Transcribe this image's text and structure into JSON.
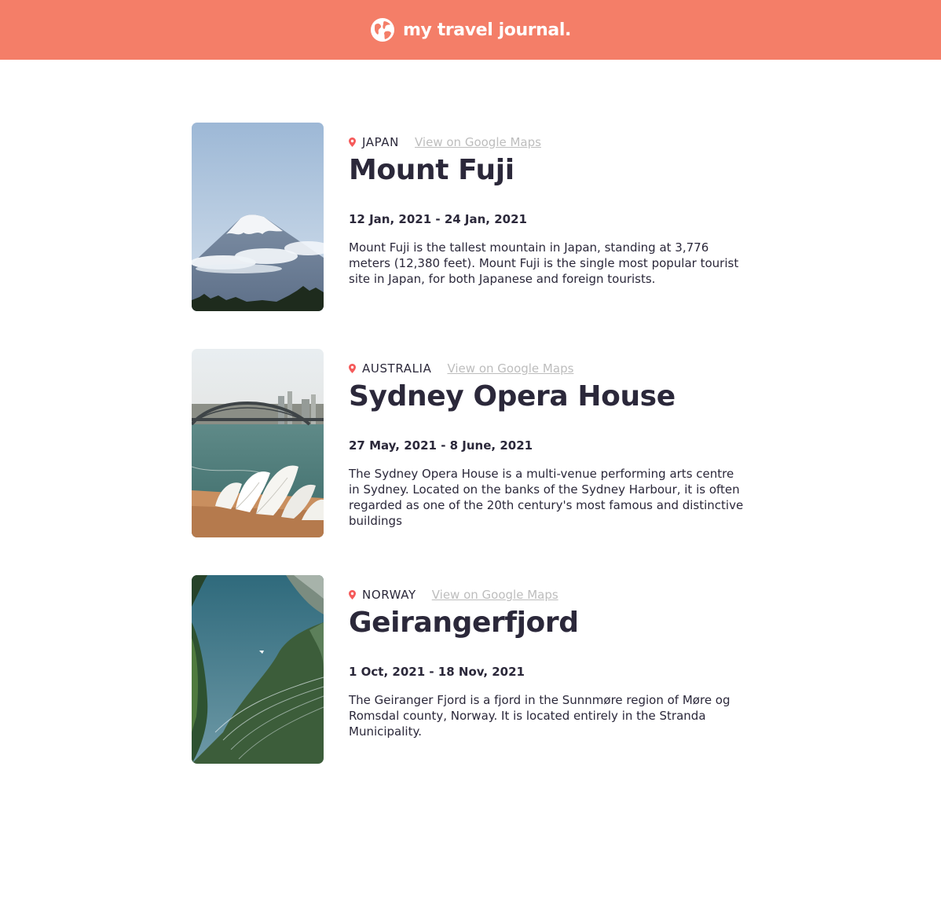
{
  "header": {
    "title": "my travel journal.",
    "icon": "globe-icon",
    "background": "#f47e68"
  },
  "entries": [
    {
      "country": "JAPAN",
      "maps_link": "View on Google Maps",
      "title": "Mount Fuji",
      "dates": "12 Jan, 2021 - 24 Jan, 2021",
      "description": "Mount Fuji is the tallest mountain in Japan, standing at 3,776 meters (12,380 feet). Mount Fuji is the single most popular tourist site in Japan, for both Japanese and foreign tourists."
    },
    {
      "country": "AUSTRALIA",
      "maps_link": "View on Google Maps",
      "title": "Sydney Opera House",
      "dates": "27 May, 2021 - 8 June, 2021",
      "description": "The Sydney Opera House is a multi-venue performing arts centre in Sydney. Located on the banks of the Sydney Harbour, it is often regarded as one of the 20th century's most famous and distinctive buildings"
    },
    {
      "country": "NORWAY",
      "maps_link": "View on Google Maps",
      "title": "Geirangerfjord",
      "dates": "1 Oct, 2021 - 18 Nov, 2021",
      "description": "The Geiranger Fjord is a fjord in the Sunnmøre region of Møre og Romsdal county, Norway. It is located entirely in the Stranda Municipality."
    }
  ],
  "colors": {
    "accent": "#f47e68",
    "text": "#2b283a",
    "link": "#bdbdbd"
  }
}
